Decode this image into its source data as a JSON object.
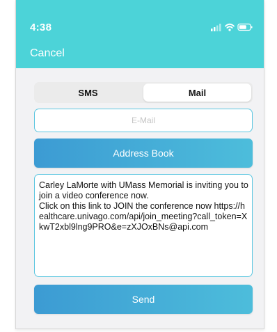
{
  "status_bar": {
    "time": "4:38",
    "icons": [
      "signal-icon",
      "wifi-icon",
      "battery-icon"
    ]
  },
  "header": {
    "cancel_label": "Cancel"
  },
  "segmented": {
    "options": [
      "SMS",
      "Mail"
    ],
    "selected": "Mail"
  },
  "email": {
    "placeholder": "E-Mail",
    "value": ""
  },
  "address_book_label": "Address Book",
  "message": {
    "text": "Carley LaMorte with UMass Memorial is inviting you to join a video conference now.\nClick on this link to JOIN the conference now https://healthcare.univago.com/api/join_meeting?call_token=XkwT2xbl9lng9PRO&e=zXJOxBNs@api.com"
  },
  "send_label": "Send",
  "colors": {
    "header_bg": "#4cd3d8",
    "button_gradient_start": "#3c9bd3",
    "button_gradient_end": "#4dbddb",
    "field_border": "#5bc6e0",
    "content_bg": "#f2f2f4"
  }
}
